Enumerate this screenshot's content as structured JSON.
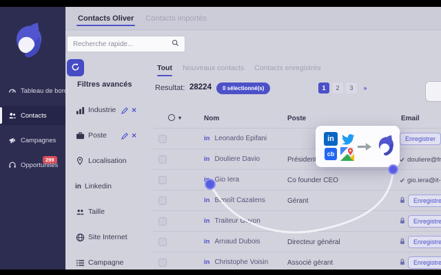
{
  "sidebar": {
    "items": [
      {
        "label": "Tableau de bord",
        "icon": "gauge-icon",
        "active": false
      },
      {
        "label": "Contacts",
        "icon": "people-icon",
        "active": true
      },
      {
        "label": "Campagnes",
        "icon": "megaphone-icon",
        "active": false
      },
      {
        "label": "Opportunités",
        "icon": "headset-icon",
        "badge": "299",
        "active": false
      }
    ]
  },
  "header": {
    "tabs": [
      {
        "label": "Contacts Oliver",
        "active": true
      },
      {
        "label": "Contacts importés",
        "active": false
      }
    ]
  },
  "search": {
    "placeholder": "Recherche rapide...",
    "icon": "search-icon"
  },
  "filters": {
    "title": "Filtres avancés",
    "refresh_icon": "refresh-icon",
    "remove_glyph": "×",
    "linkedin_glyph": "in",
    "items": [
      {
        "label": "Industrie",
        "icon": "industry-icon",
        "editable": true
      },
      {
        "label": "Poste",
        "icon": "briefcase-icon",
        "editable": true
      },
      {
        "label": "Localisation",
        "icon": "location-pin-icon",
        "editable": false
      },
      {
        "label": "Linkedin",
        "icon": "linkedin-icon",
        "editable": false
      },
      {
        "label": "Taille",
        "icon": "company-size-icon",
        "editable": false
      },
      {
        "label": "Site Internet",
        "icon": "globe-icon",
        "editable": false
      },
      {
        "label": "Campagne",
        "icon": "list-icon",
        "editable": false
      }
    ]
  },
  "content": {
    "tabs": [
      {
        "label": "Tout",
        "active": true
      },
      {
        "label": "Nouveaux contacts",
        "active": false
      },
      {
        "label": "Contacts enregistrés",
        "active": false
      }
    ],
    "result_label": "Resultat:",
    "result_count": "28224",
    "selected_badge": "0 sélectionné(s)",
    "pagination": [
      "1",
      "2",
      "3",
      "»"
    ],
    "table": {
      "linkedin_glyph": "in",
      "columns": [
        "Nom",
        "Poste",
        "Email"
      ],
      "rows": [
        {
          "name": "Leonardo Epifani",
          "poste": "",
          "email_type": "button",
          "email_label": "Enregistrer"
        },
        {
          "name": "Douliere Davio",
          "poste": "Président D",
          "email_type": "text",
          "email": "douliere@free"
        },
        {
          "name": "Gio Iera",
          "poste": "Co founder CEO",
          "email_type": "text",
          "email": "gio.iera@it-tra"
        },
        {
          "name": "Benoît Cazalens",
          "poste": "Gérant",
          "email_type": "locked",
          "email_label": "Enregistrer"
        },
        {
          "name": "Traiteur Guyon",
          "poste": "",
          "email_type": "locked",
          "email_label": "Enregistrer"
        },
        {
          "name": "Arnaud Dubois",
          "poste": "Directeur général",
          "email_type": "locked",
          "email_label": "Enregistrer"
        },
        {
          "name": "Christophe Voisin",
          "poste": "Associé gérant",
          "email_type": "locked",
          "email_label": "Enregistrer"
        }
      ]
    }
  },
  "overlay": {
    "linkedin_glyph": "in",
    "crunchbase_glyph": "cb",
    "icons": [
      "linkedin-icon",
      "twitter-icon",
      "crunchbase-icon",
      "google-maps-icon",
      "arrow-right-icon",
      "fox-logo"
    ]
  },
  "colors": {
    "accent_indigo": "#4d51c8",
    "sidebar_bg": "#2d2d51",
    "badge_red": "#d94f5c",
    "page_bg": "#d2d2dd",
    "linkedin_blue": "#0a66c2",
    "twitter_blue": "#1d9bf0",
    "crunchbase_blue": "#2167f3",
    "dot_blue": "#585ce0"
  }
}
